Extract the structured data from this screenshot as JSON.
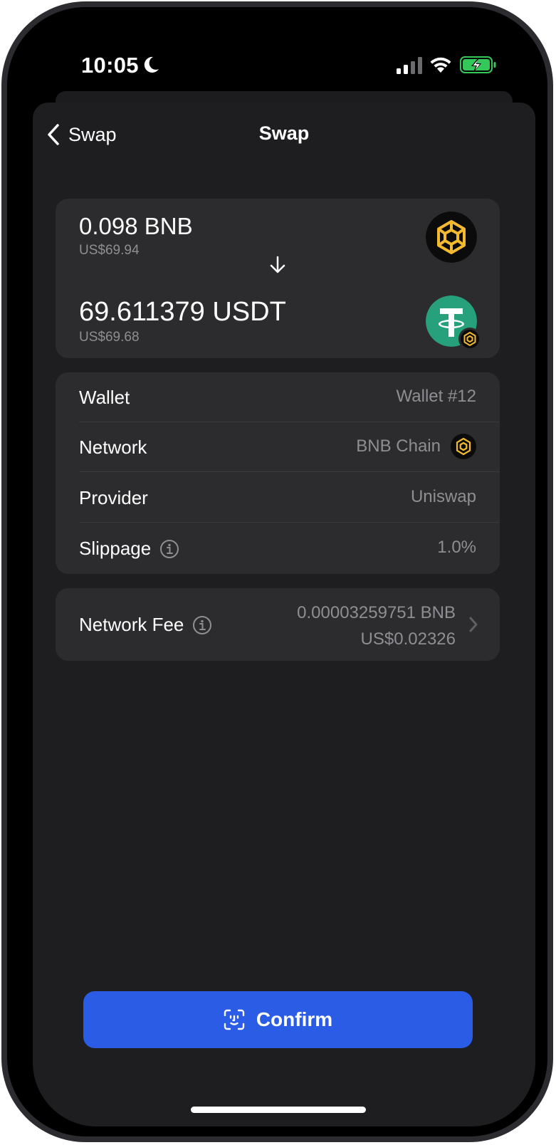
{
  "status_bar": {
    "time": "10:05",
    "icons": [
      "moon-icon",
      "cellular-signal-icon",
      "wifi-icon",
      "battery-charging-icon"
    ],
    "battery_color": "#34c759"
  },
  "nav": {
    "back_label": "Swap",
    "title": "Swap"
  },
  "swap": {
    "from": {
      "amount": "0.098 BNB",
      "fiat": "US$69.94",
      "icon": "bnb-icon"
    },
    "to": {
      "amount": "69.611379 USDT",
      "fiat": "US$69.68",
      "icon": "usdt-icon",
      "network_badge": "bnb-icon"
    }
  },
  "details": {
    "wallet": {
      "label": "Wallet",
      "value": "Wallet #12"
    },
    "network": {
      "label": "Network",
      "value": "BNB Chain",
      "icon": "bnb-icon"
    },
    "provider": {
      "label": "Provider",
      "value": "Uniswap"
    },
    "slippage": {
      "label": "Slippage",
      "value": "1.0%"
    }
  },
  "fee": {
    "label": "Network Fee",
    "crypto": "0.00003259751 BNB",
    "fiat": "US$0.02326"
  },
  "confirm": {
    "label": "Confirm",
    "icon": "face-id-icon"
  },
  "colors": {
    "accent": "#2b5ce6",
    "bnb": "#f3ba2f",
    "usdt": "#26a17b",
    "card": "#2c2c2e",
    "secondary_text": "#8e8e93"
  }
}
